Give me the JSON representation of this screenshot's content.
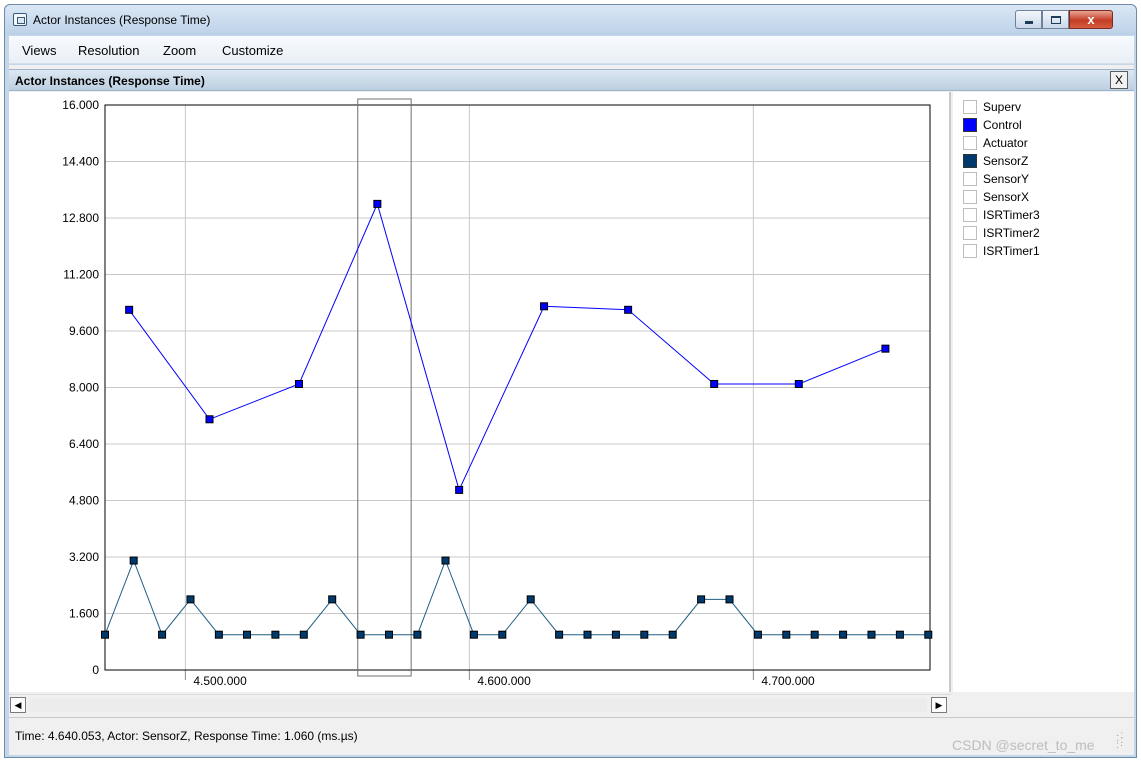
{
  "window": {
    "title": "Actor Instances (Response Time)",
    "close_glyph": "x"
  },
  "menu": {
    "items": [
      "Views",
      "Resolution",
      "Zoom",
      "Customize"
    ]
  },
  "panel": {
    "title": "Actor Instances (Response Time)",
    "close_label": "X"
  },
  "legend": {
    "items": [
      {
        "label": "Superv",
        "color": "#ffffff"
      },
      {
        "label": "Control",
        "color": "#0000ff"
      },
      {
        "label": "Actuator",
        "color": "#ffffff"
      },
      {
        "label": "SensorZ",
        "color": "#003a6c"
      },
      {
        "label": "SensorY",
        "color": "#ffffff"
      },
      {
        "label": "SensorX",
        "color": "#ffffff"
      },
      {
        "label": "ISRTimer3",
        "color": "#ffffff"
      },
      {
        "label": "ISRTimer2",
        "color": "#ffffff"
      },
      {
        "label": "ISRTimer1",
        "color": "#ffffff"
      }
    ]
  },
  "status": {
    "text": "Time: 4.640.053, Actor: SensorZ, Response Time: 1.060 (ms.µs)"
  },
  "watermark": {
    "text": "CSDN @secret_to_me"
  },
  "chart_data": {
    "type": "line",
    "xlim": [
      4.4717,
      4.7622
    ],
    "ylim": [
      0,
      16
    ],
    "yticks": [
      {
        "value": 0,
        "label": "0"
      },
      {
        "value": 1.6,
        "label": "1.600"
      },
      {
        "value": 3.2,
        "label": "3.200"
      },
      {
        "value": 4.8,
        "label": "4.800"
      },
      {
        "value": 6.4,
        "label": "6.400"
      },
      {
        "value": 8.0,
        "label": "8.000"
      },
      {
        "value": 9.6,
        "label": "9.600"
      },
      {
        "value": 11.2,
        "label": "11.200"
      },
      {
        "value": 12.8,
        "label": "12.800"
      },
      {
        "value": 14.4,
        "label": "14.400"
      },
      {
        "value": 16.0,
        "label": "16.000"
      }
    ],
    "xticks": [
      {
        "value": 4.5,
        "label": "4.500.000"
      },
      {
        "value": 4.6,
        "label": "4.600.000"
      },
      {
        "value": 4.7,
        "label": "4.700.000"
      }
    ],
    "grid": true,
    "selection_range": [
      4.5607,
      4.5795
    ],
    "series": [
      {
        "name": "Control",
        "color": "#0000ff",
        "marker_color": "#0000ff",
        "x": [
          4.4802,
          4.5085,
          4.54,
          4.5676,
          4.5964,
          4.6263,
          4.6559,
          4.6862,
          4.716,
          4.7465
        ],
        "y": [
          10.2,
          7.1,
          8.1,
          13.2,
          5.1,
          10.3,
          10.2,
          8.1,
          8.1,
          9.1
        ]
      },
      {
        "name": "SensorZ",
        "color": "#1f5f86",
        "marker_color": "#003a6c",
        "x": [
          4.4717,
          4.4818,
          4.4918,
          4.5018,
          4.5118,
          4.5217,
          4.5317,
          4.5417,
          4.5517,
          4.5617,
          4.5717,
          4.5817,
          4.5916,
          4.6016,
          4.6116,
          4.6216,
          4.6316,
          4.6416,
          4.6516,
          4.6616,
          4.6716,
          4.6816,
          4.6916,
          4.7016,
          4.7116,
          4.7216,
          4.7316,
          4.7416,
          4.7516,
          4.7616
        ],
        "y": [
          1.0,
          3.1,
          1.0,
          2.0,
          1.0,
          1.0,
          1.0,
          1.0,
          2.0,
          1.0,
          1.0,
          1.0,
          3.1,
          1.0,
          1.0,
          2.0,
          1.0,
          1.0,
          1.0,
          1.0,
          1.0,
          2.0,
          2.0,
          1.0,
          1.0,
          1.0,
          1.0,
          1.0,
          1.0,
          1.0
        ]
      }
    ]
  }
}
